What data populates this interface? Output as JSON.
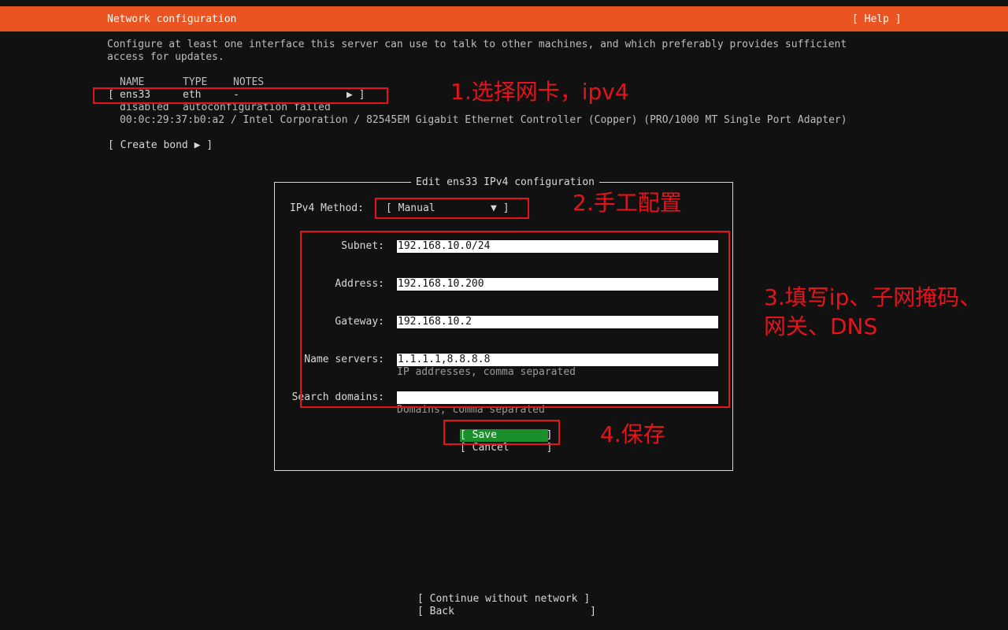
{
  "header": {
    "title": "Network configuration",
    "help": "[ Help ]"
  },
  "description": {
    "line1": "Configure at least one interface this server can use to talk to other machines, and which preferably provides sufficient",
    "line2": "access for updates."
  },
  "interfaces": {
    "columns": {
      "name": "NAME",
      "type": "TYPE",
      "notes": "NOTES"
    },
    "row": {
      "open_bracket": "[",
      "name": "ens33",
      "type": "eth",
      "notes": "-",
      "arrow": "▶ ]",
      "status": "disabled",
      "status_detail": "autoconfiguration failed",
      "hw_info": "00:0c:29:37:b0:a2 / Intel Corporation / 82545EM Gigabit Ethernet Controller (Copper) (PRO/1000 MT Single Port Adapter)"
    },
    "create_bond": "[ Create bond ▶ ]"
  },
  "dialog": {
    "title": "Edit ens33 IPv4 configuration",
    "method_label": "IPv4 Method:",
    "method_value": "[ Manual         ▼ ]",
    "fields": {
      "subnet": {
        "label": "Subnet:",
        "value": "192.168.10.0/24"
      },
      "address": {
        "label": "Address:",
        "value": "192.168.10.200"
      },
      "gateway": {
        "label": "Gateway:",
        "value": "192.168.10.2"
      },
      "name_servers": {
        "label": "Name servers:",
        "value": "1.1.1.1,8.8.8.8",
        "hint": "IP addresses, comma separated"
      },
      "search_domains": {
        "label": "Search domains:",
        "value": "",
        "hint": "Domains, comma separated"
      }
    },
    "save": "[ Save        ]",
    "cancel": "[ Cancel      ]"
  },
  "footer": {
    "continue": "[ Continue without network ]",
    "back": "[ Back                      ]"
  },
  "annotations": {
    "step1": "1.选择网卡，ipv4",
    "step2": "2.手工配置",
    "step3_line1": "3.填写ip、子网掩码、",
    "step3_line2": "网关、DNS",
    "step4": "4.保存"
  },
  "colors": {
    "accent": "#e95420",
    "save_bg": "#1a8f2c",
    "annotation": "#e8121a",
    "background": "#111111"
  }
}
